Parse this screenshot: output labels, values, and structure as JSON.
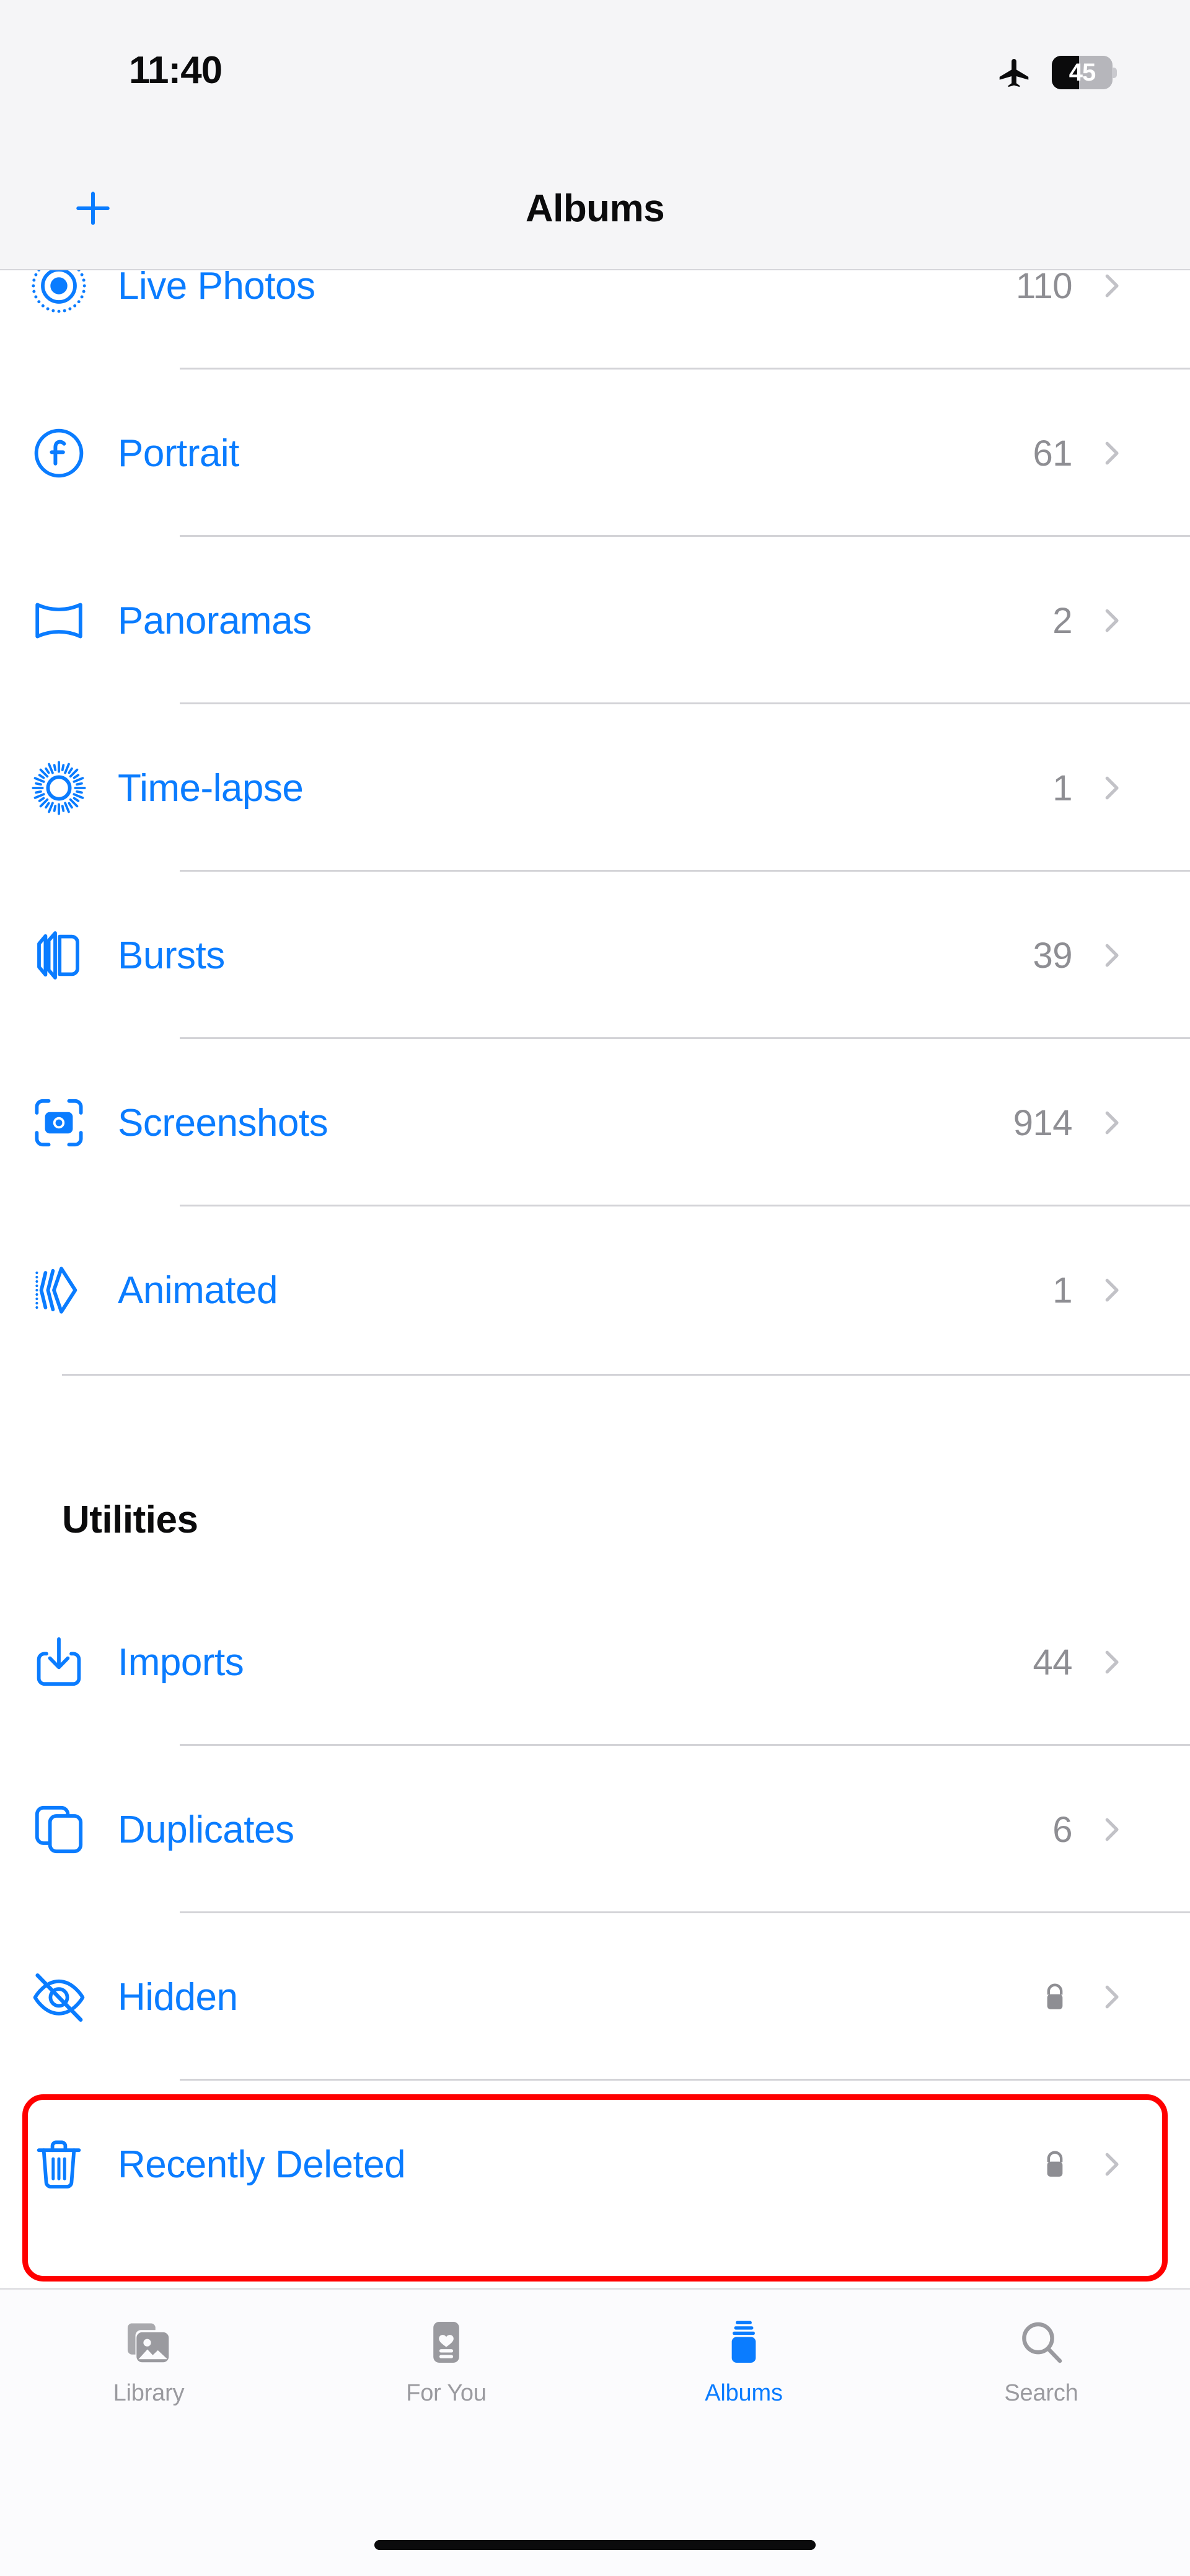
{
  "status_bar": {
    "time": "11:40",
    "airplane_icon": "airplane-mode-icon",
    "battery_percent": "45",
    "battery_level": 45
  },
  "nav_bar": {
    "add_icon": "plus-icon",
    "title": "Albums"
  },
  "media_types_section": {
    "rows": [
      {
        "label": "Live Photos",
        "count": "110",
        "icon": "live-photos-icon",
        "locked": false
      },
      {
        "label": "Portrait",
        "count": "61",
        "icon": "portrait-f-icon",
        "locked": false
      },
      {
        "label": "Panoramas",
        "count": "2",
        "icon": "panorama-icon",
        "locked": false
      },
      {
        "label": "Time-lapse",
        "count": "1",
        "icon": "timelapse-icon",
        "locked": false
      },
      {
        "label": "Bursts",
        "count": "39",
        "icon": "bursts-icon",
        "locked": false
      },
      {
        "label": "Screenshots",
        "count": "914",
        "icon": "screenshots-icon",
        "locked": false
      },
      {
        "label": "Animated",
        "count": "1",
        "icon": "animated-icon",
        "locked": false
      }
    ]
  },
  "utilities_section": {
    "header": "Utilities",
    "rows": [
      {
        "label": "Imports",
        "count": "44",
        "icon": "imports-icon",
        "locked": false
      },
      {
        "label": "Duplicates",
        "count": "6",
        "icon": "duplicates-icon",
        "locked": false
      },
      {
        "label": "Hidden",
        "count": "",
        "icon": "eye-slash-icon",
        "locked": true
      },
      {
        "label": "Recently Deleted",
        "count": "",
        "icon": "trash-icon",
        "locked": true
      }
    ]
  },
  "highlight": {
    "target": "Recently Deleted",
    "color": "#ff0000"
  },
  "tab_bar": {
    "tabs": [
      {
        "label": "Library",
        "icon": "photo-stack-icon",
        "active": false
      },
      {
        "label": "For You",
        "icon": "heart-card-icon",
        "active": false
      },
      {
        "label": "Albums",
        "icon": "albums-book-icon",
        "active": true
      },
      {
        "label": "Search",
        "icon": "magnifier-icon",
        "active": false
      }
    ]
  },
  "colors": {
    "accent": "#0a7cff",
    "secondary_text": "#8e8e93",
    "highlight": "#ff0000",
    "chrome_bg": "#f5f5f7"
  },
  "home_indicator": "home-indicator"
}
